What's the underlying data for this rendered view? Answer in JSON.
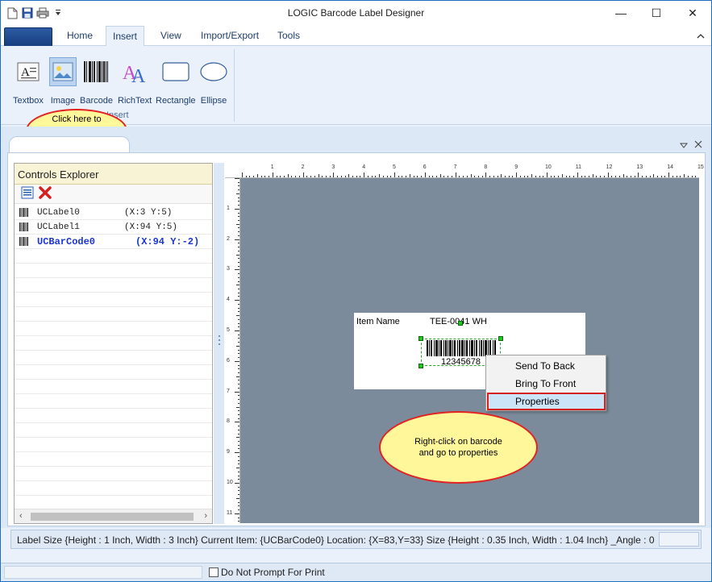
{
  "window": {
    "title": "LOGIC Barcode Label Designer",
    "controls": {
      "minimize": "—",
      "maximize": "☐",
      "close": "✕"
    }
  },
  "ribbon": {
    "tabs": [
      "Home",
      "Insert",
      "View",
      "Import/Export",
      "Tools"
    ],
    "active_tab": "Insert",
    "insert_buttons": [
      "Textbox",
      "Image",
      "Barcode",
      "RichText",
      "Rectangle",
      "Ellipse"
    ],
    "group_label": "Insert"
  },
  "callouts": {
    "insert_barcode": "Click here to insert Barcode",
    "properties_hint": "Right-click on barcode and go to properties"
  },
  "explorer": {
    "title": "Controls Explorer",
    "items": [
      {
        "name": "UCLabel0",
        "pos": "(X:3 Y:5)"
      },
      {
        "name": "UCLabel1",
        "pos": "(X:94 Y:5)"
      },
      {
        "name": "UCBarCode0",
        "pos": "(X:94 Y:-2)"
      }
    ],
    "selected_index": 2
  },
  "ruler": {
    "h_numbers": [
      "1",
      "2",
      "3",
      "4",
      "5",
      "6",
      "7",
      "8",
      "9",
      "10",
      "11",
      "12",
      "13",
      "14",
      "15"
    ],
    "v_numbers": [
      "1",
      "2",
      "3",
      "4",
      "5",
      "6",
      "7",
      "8",
      "9",
      "10",
      "11"
    ]
  },
  "label": {
    "item_name_caption": "Item Name",
    "item_name_value": "TEE-0041 WH",
    "barcode_value": "12345678"
  },
  "context_menu": {
    "items": [
      "Send To Back",
      "Bring To Front",
      "Properties"
    ],
    "highlighted": "Properties"
  },
  "status": {
    "text": "Label Size {Height : 1 Inch, Width : 3 Inch}  Current Item: {UCBarCode0} Location: {X=83,Y=33} Size {Height : 0.35 Inch, Width : 1.04 Inch} _Angle : 0"
  },
  "bottom": {
    "checkbox_label": "Do Not Prompt For Print",
    "checked": false
  },
  "colors": {
    "accent": "#1f6fc0",
    "canvas_bg": "#7b8b9b",
    "callout_fill": "#fff799",
    "callout_border": "#e12323",
    "selected_text": "#1a34d6"
  }
}
